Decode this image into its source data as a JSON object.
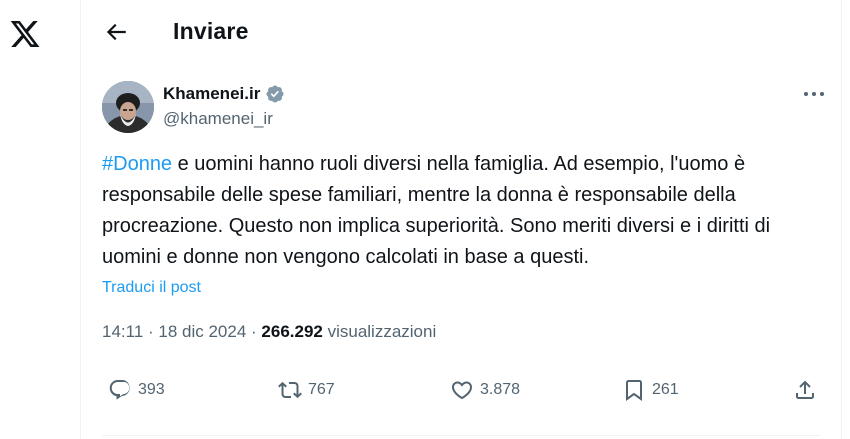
{
  "header": {
    "title": "Inviare"
  },
  "author": {
    "display_name": "Khamenei.ir",
    "handle": "@khamenei_ir"
  },
  "tweet": {
    "hashtag": "#Donne",
    "text": " e uomini hanno ruoli diversi nella famiglia. Ad esempio, l'uomo è responsabile delle spese familiari, mentre la donna è responsabile della procreazione. Questo non implica superiorità. Sono meriti diversi e i diritti di uomini e donne non vengono calcolati in base a questi."
  },
  "translate_label": "Traduci il post",
  "meta": {
    "time": "14:11",
    "sep1": " · ",
    "date": "18 dic 2024",
    "sep2": " · ",
    "views_count": "266.292",
    "views_label": " visualizzazioni"
  },
  "actions": {
    "replies": "393",
    "reposts": "767",
    "likes": "3.878",
    "bookmarks": "261"
  },
  "icons": {
    "logo": "x-logo-icon",
    "back": "arrow-left-icon",
    "verified": "verified-badge-icon",
    "more": "more-horizontal-icon",
    "reply": "reply-icon",
    "repost": "repost-icon",
    "like": "heart-icon",
    "bookmark": "bookmark-icon",
    "share": "share-icon"
  },
  "colors": {
    "accent": "#1d9bf0",
    "text": "#0f1419",
    "secondary": "#536471",
    "verified": "#829aab"
  }
}
